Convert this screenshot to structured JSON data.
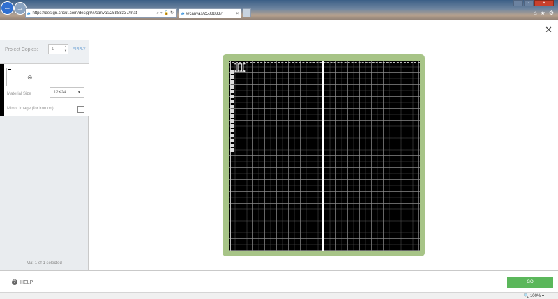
{
  "browser": {
    "url": "https://design.cricut.com/design/#/canvas/25888337/mat",
    "tab_title": "#/canvas/25888337",
    "tab_close": "×",
    "zoom": "100%",
    "back_icon": "arrow-left-icon",
    "forward_icon": "arrow-right-icon"
  },
  "modal": {
    "close_label": "✕"
  },
  "left_panel": {
    "copies_label": "Project Copies:",
    "copies_value": "1",
    "apply_label": "APPLY",
    "mat_size_label": "Material Size",
    "mat_size_value": "12X24",
    "mirror_label": "Mirror Image (for iron on)",
    "status_text": "Mat 1 of 1 selected"
  },
  "footer": {
    "help_label": "HELP",
    "go_label": "GO"
  },
  "colors": {
    "mat_border": "#a7c487",
    "go_button": "#5bb75b",
    "apply_link": "#6aa0d4"
  }
}
